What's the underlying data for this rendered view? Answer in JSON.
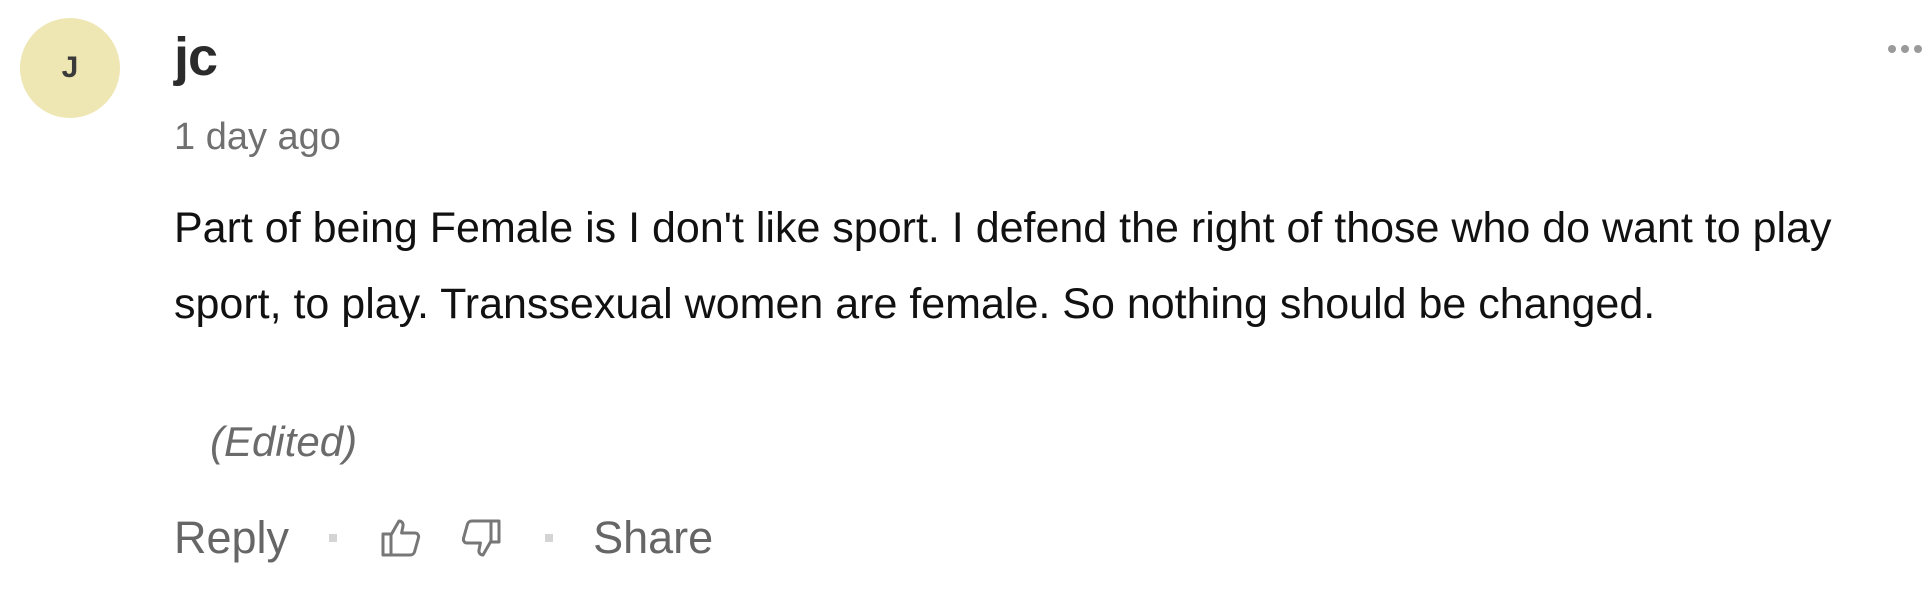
{
  "comment": {
    "avatar_initial": "J",
    "avatar_color": "#efe7b3",
    "author": "jc",
    "timestamp": "1 day ago",
    "body": "Part of being Female is I don't like sport. I defend the right of those who do want to play sport, to play. Transsexual women are female. So nothing should be changed.",
    "edited_label": "(Edited)",
    "more_icon": "more-options-icon"
  },
  "actions": {
    "reply_label": "Reply",
    "upvote_icon": "thumbs-up-icon",
    "downvote_icon": "thumbs-down-icon",
    "share_label": "Share"
  }
}
